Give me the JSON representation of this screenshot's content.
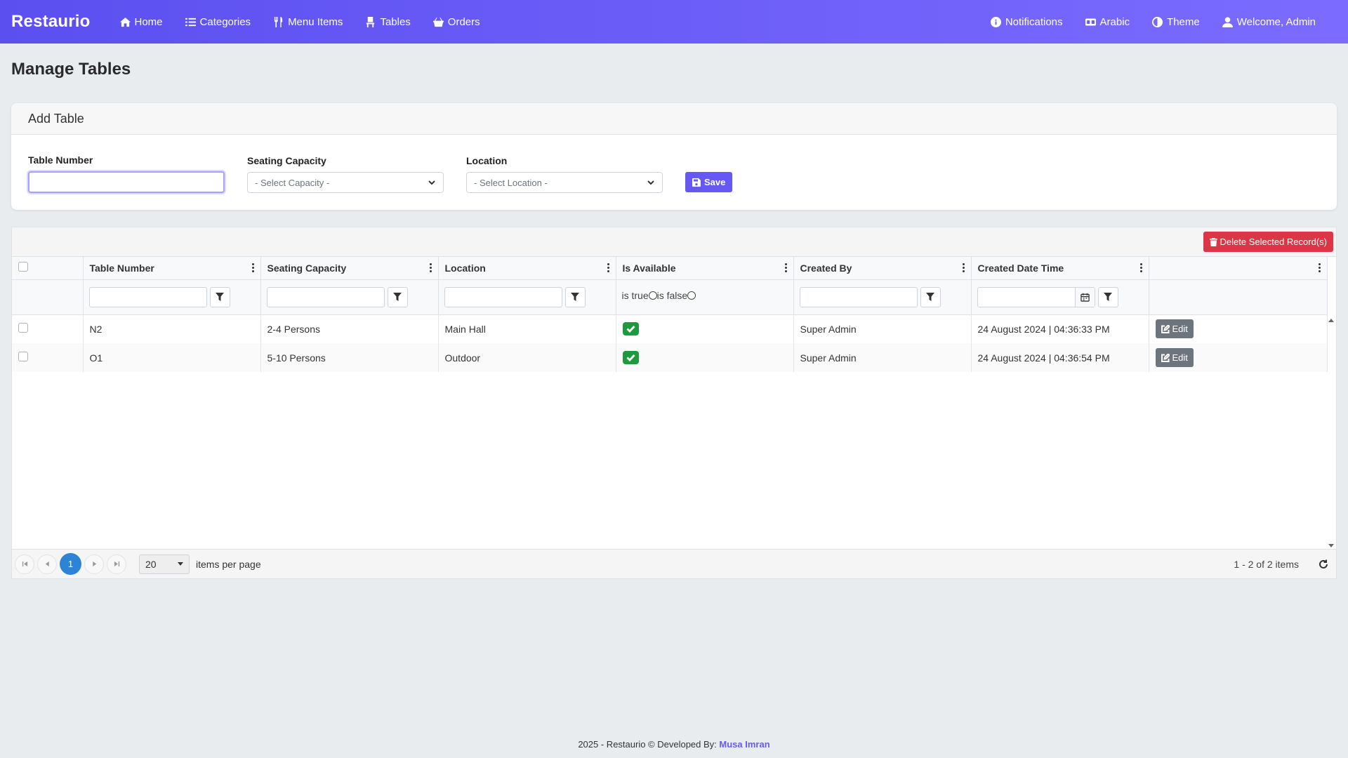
{
  "navbar": {
    "brand": "Restaurio",
    "left_items": [
      {
        "label": "Home",
        "icon": "home-icon"
      },
      {
        "label": "Categories",
        "icon": "list-icon"
      },
      {
        "label": "Menu Items",
        "icon": "utensils-icon"
      },
      {
        "label": "Tables",
        "icon": "chair-icon"
      },
      {
        "label": "Orders",
        "icon": "basket-icon"
      }
    ],
    "right_items": [
      {
        "label": "Notifications",
        "icon": "info-icon"
      },
      {
        "label": "Arabic",
        "icon": "language-icon"
      },
      {
        "label": "Theme",
        "icon": "contrast-icon"
      },
      {
        "label": "Welcome, Admin",
        "icon": "user-icon"
      }
    ]
  },
  "page": {
    "title": "Manage Tables"
  },
  "add_form": {
    "header": "Add Table",
    "table_number_label": "Table Number",
    "table_number_value": "",
    "seating_capacity_label": "Seating Capacity",
    "seating_capacity_selected": "- Select Capacity -",
    "location_label": "Location",
    "location_selected": "- Select Location -",
    "save_label": "Save"
  },
  "grid": {
    "delete_label": "Delete Selected Record(s)",
    "columns": [
      "Table Number",
      "Seating Capacity",
      "Location",
      "Is Available",
      "Created By",
      "Created Date Time",
      ""
    ],
    "filter_true_label": "is true",
    "filter_false_label": "is false",
    "rows": [
      {
        "table_number": "N2",
        "capacity": "2-4 Persons",
        "location": "Main Hall",
        "available": true,
        "created_by": "Super Admin",
        "created": "24 August 2024 | 04:36:33 PM",
        "action": "Edit"
      },
      {
        "table_number": "O1",
        "capacity": "5-10 Persons",
        "location": "Outdoor",
        "available": true,
        "created_by": "Super Admin",
        "created": "24 August 2024 | 04:36:54 PM",
        "action": "Edit"
      }
    ],
    "pager": {
      "current_page": "1",
      "page_size": "20",
      "items_per_page_label": "items per page",
      "info": "1 - 2 of 2 items"
    }
  },
  "footer": {
    "text": "2025 - Restaurio © Developed By: ",
    "developer": "Musa Imran"
  },
  "colors": {
    "navbar_start": "#5b4ff0",
    "navbar_end": "#7b6cff",
    "primary": "#6658f2",
    "danger": "#dc3545",
    "success": "#1e9a3e",
    "pager_active": "#2d83d5"
  }
}
